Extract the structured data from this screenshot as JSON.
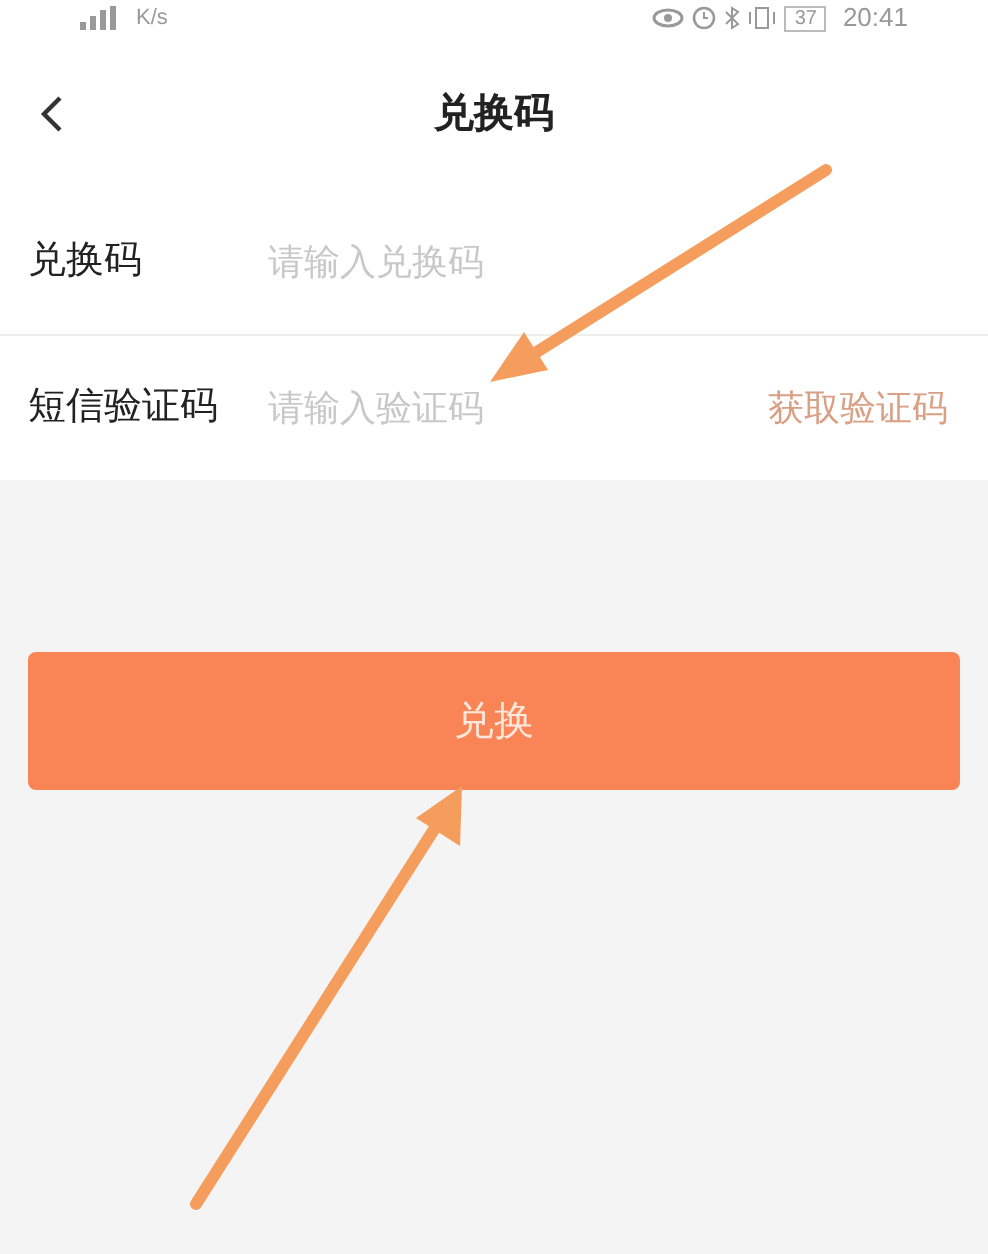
{
  "status_bar": {
    "speed_unit": "K/s",
    "battery": "37",
    "time": "20:41"
  },
  "header": {
    "title": "兑换码"
  },
  "fields": [
    {
      "label": "兑换码",
      "placeholder": "请输入兑换码"
    },
    {
      "label": "短信验证码",
      "placeholder": "请输入验证码",
      "action": "获取验证码"
    }
  ],
  "submit": {
    "label": "兑换"
  }
}
